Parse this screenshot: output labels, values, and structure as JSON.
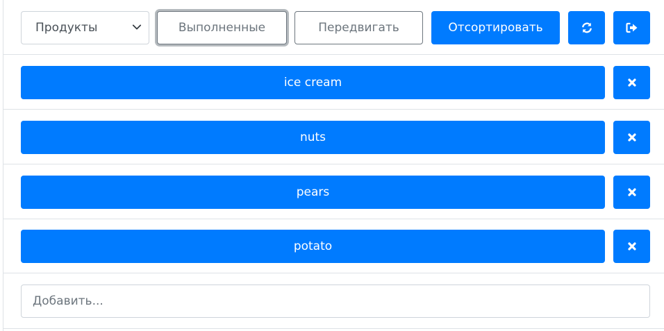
{
  "toolbar": {
    "category_select": {
      "selected": "Продукты"
    },
    "done_label": "Выполненные",
    "move_label": "Передвигать",
    "sort_label": "Отсортировать",
    "refresh_icon": "refresh-icon",
    "logout_icon": "sign-out-icon"
  },
  "items": [
    {
      "label": "ice cream"
    },
    {
      "label": "nuts"
    },
    {
      "label": "pears"
    },
    {
      "label": "potato"
    }
  ],
  "add": {
    "placeholder": "Добавить...",
    "value": ""
  },
  "colors": {
    "primary": "#007bff",
    "secondary": "#6c757d",
    "border": "#dee2e6"
  }
}
